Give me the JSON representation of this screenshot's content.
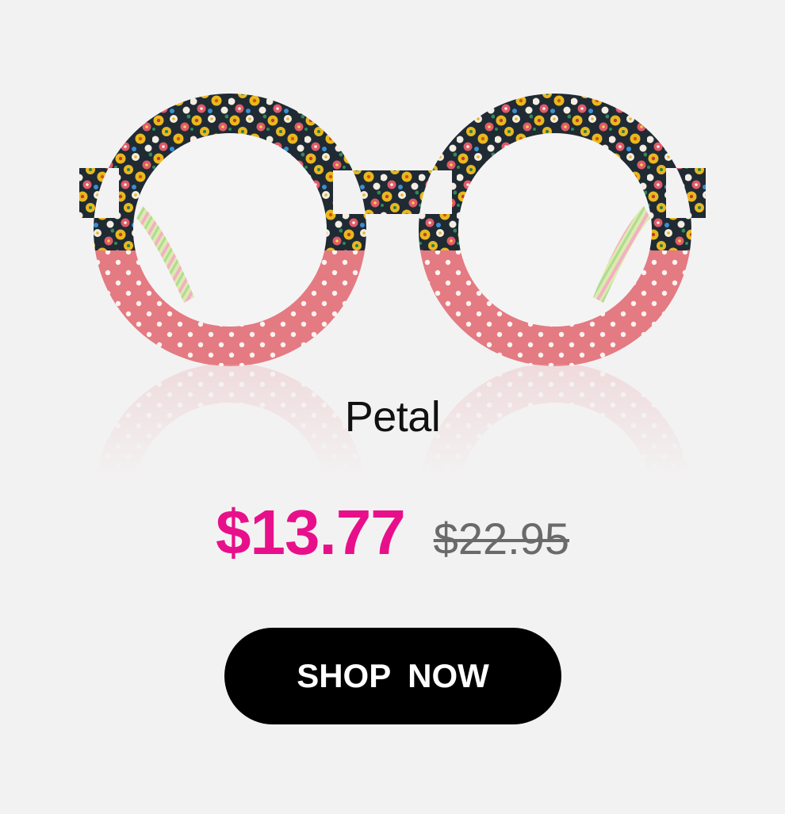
{
  "product": {
    "image_alt": "Petal round glasses with floral and polka dot frame",
    "name": "Petal",
    "sale_price": "$13.77",
    "original_price": "$22.95",
    "cta_label": "SHOP NOW"
  },
  "colors": {
    "background": "#f3f2f2",
    "sale_price": "#e8108a",
    "original_price": "#6a6a6a",
    "button_bg": "#000000",
    "button_text": "#ffffff",
    "frame_floral_dark": "#1f2a33",
    "frame_floral_yellow": "#e8b820",
    "frame_floral_pink": "#e05a6a",
    "frame_polka_pink": "#e47a82",
    "frame_dot_white": "#fbf5f0"
  }
}
